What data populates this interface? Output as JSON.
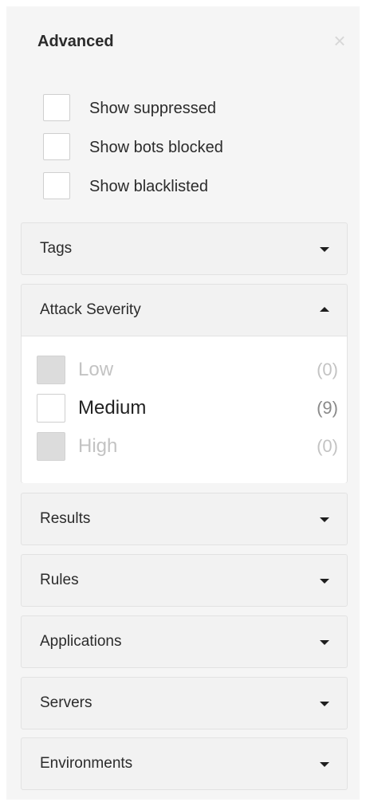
{
  "panel": {
    "title": "Advanced",
    "close_symbol": "×"
  },
  "options": [
    {
      "label": "Show suppressed",
      "checked": false
    },
    {
      "label": "Show bots blocked",
      "checked": false
    },
    {
      "label": "Show blacklisted",
      "checked": false
    }
  ],
  "sections": {
    "tags": {
      "label": "Tags",
      "expanded": false
    },
    "attack_severity": {
      "label": "Attack Severity",
      "expanded": true,
      "items": [
        {
          "label": "Low",
          "count": "(0)",
          "enabled": false,
          "checked": false
        },
        {
          "label": "Medium",
          "count": "(9)",
          "enabled": true,
          "checked": false
        },
        {
          "label": "High",
          "count": "(0)",
          "enabled": false,
          "checked": false
        }
      ]
    },
    "results": {
      "label": "Results",
      "expanded": false
    },
    "rules": {
      "label": "Rules",
      "expanded": false
    },
    "applications": {
      "label": "Applications",
      "expanded": false
    },
    "servers": {
      "label": "Servers",
      "expanded": false
    },
    "environments": {
      "label": "Environments",
      "expanded": false
    }
  },
  "icons": {
    "close": "close-icon",
    "expand": "caret-down-icon",
    "collapse": "caret-up-icon"
  },
  "colors": {
    "panel_background": "#f5f5f5",
    "section_background": "#f2f2f2",
    "disabled_checkbox": "#dcdcdc"
  }
}
